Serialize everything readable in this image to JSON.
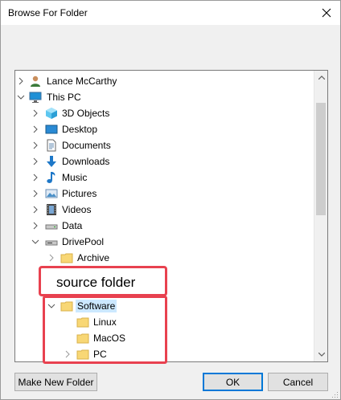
{
  "window": {
    "title": "Browse For Folder"
  },
  "tree": {
    "items": [
      {
        "label": "Lance McCarthy",
        "icon": "user-icon",
        "expander": "collapsed"
      },
      {
        "label": "This PC",
        "icon": "computer-icon",
        "expander": "expanded"
      },
      {
        "label": "3D Objects",
        "icon": "3d-objects-icon",
        "expander": "collapsed"
      },
      {
        "label": "Desktop",
        "icon": "desktop-icon",
        "expander": "collapsed"
      },
      {
        "label": "Documents",
        "icon": "documents-icon",
        "expander": "collapsed"
      },
      {
        "label": "Downloads",
        "icon": "downloads-icon",
        "expander": "collapsed"
      },
      {
        "label": "Music",
        "icon": "music-icon",
        "expander": "collapsed"
      },
      {
        "label": "Pictures",
        "icon": "pictures-icon",
        "expander": "collapsed"
      },
      {
        "label": "Videos",
        "icon": "videos-icon",
        "expander": "collapsed"
      },
      {
        "label": "Data",
        "icon": "drive-icon",
        "expander": "collapsed"
      },
      {
        "label": "DrivePool",
        "icon": "drive-icon",
        "expander": "expanded"
      },
      {
        "label": "Archive",
        "icon": "folder-icon",
        "expander": "collapsed"
      },
      {
        "label": "Software",
        "icon": "folder-icon",
        "expander": "expanded",
        "selected": true
      },
      {
        "label": "Linux",
        "icon": "folder-icon",
        "expander": "none"
      },
      {
        "label": "MacOS",
        "icon": "folder-icon",
        "expander": "none"
      },
      {
        "label": "PC",
        "icon": "folder-icon",
        "expander": "collapsed"
      }
    ]
  },
  "annotation": {
    "callout": "source folder",
    "color": "#e8414f"
  },
  "buttons": {
    "make_new_folder": "Make New Folder",
    "ok": "OK",
    "cancel": "Cancel"
  },
  "colors": {
    "selection": "#cce8ff",
    "default_button_border": "#0078d7",
    "folder": "#f8d775"
  }
}
